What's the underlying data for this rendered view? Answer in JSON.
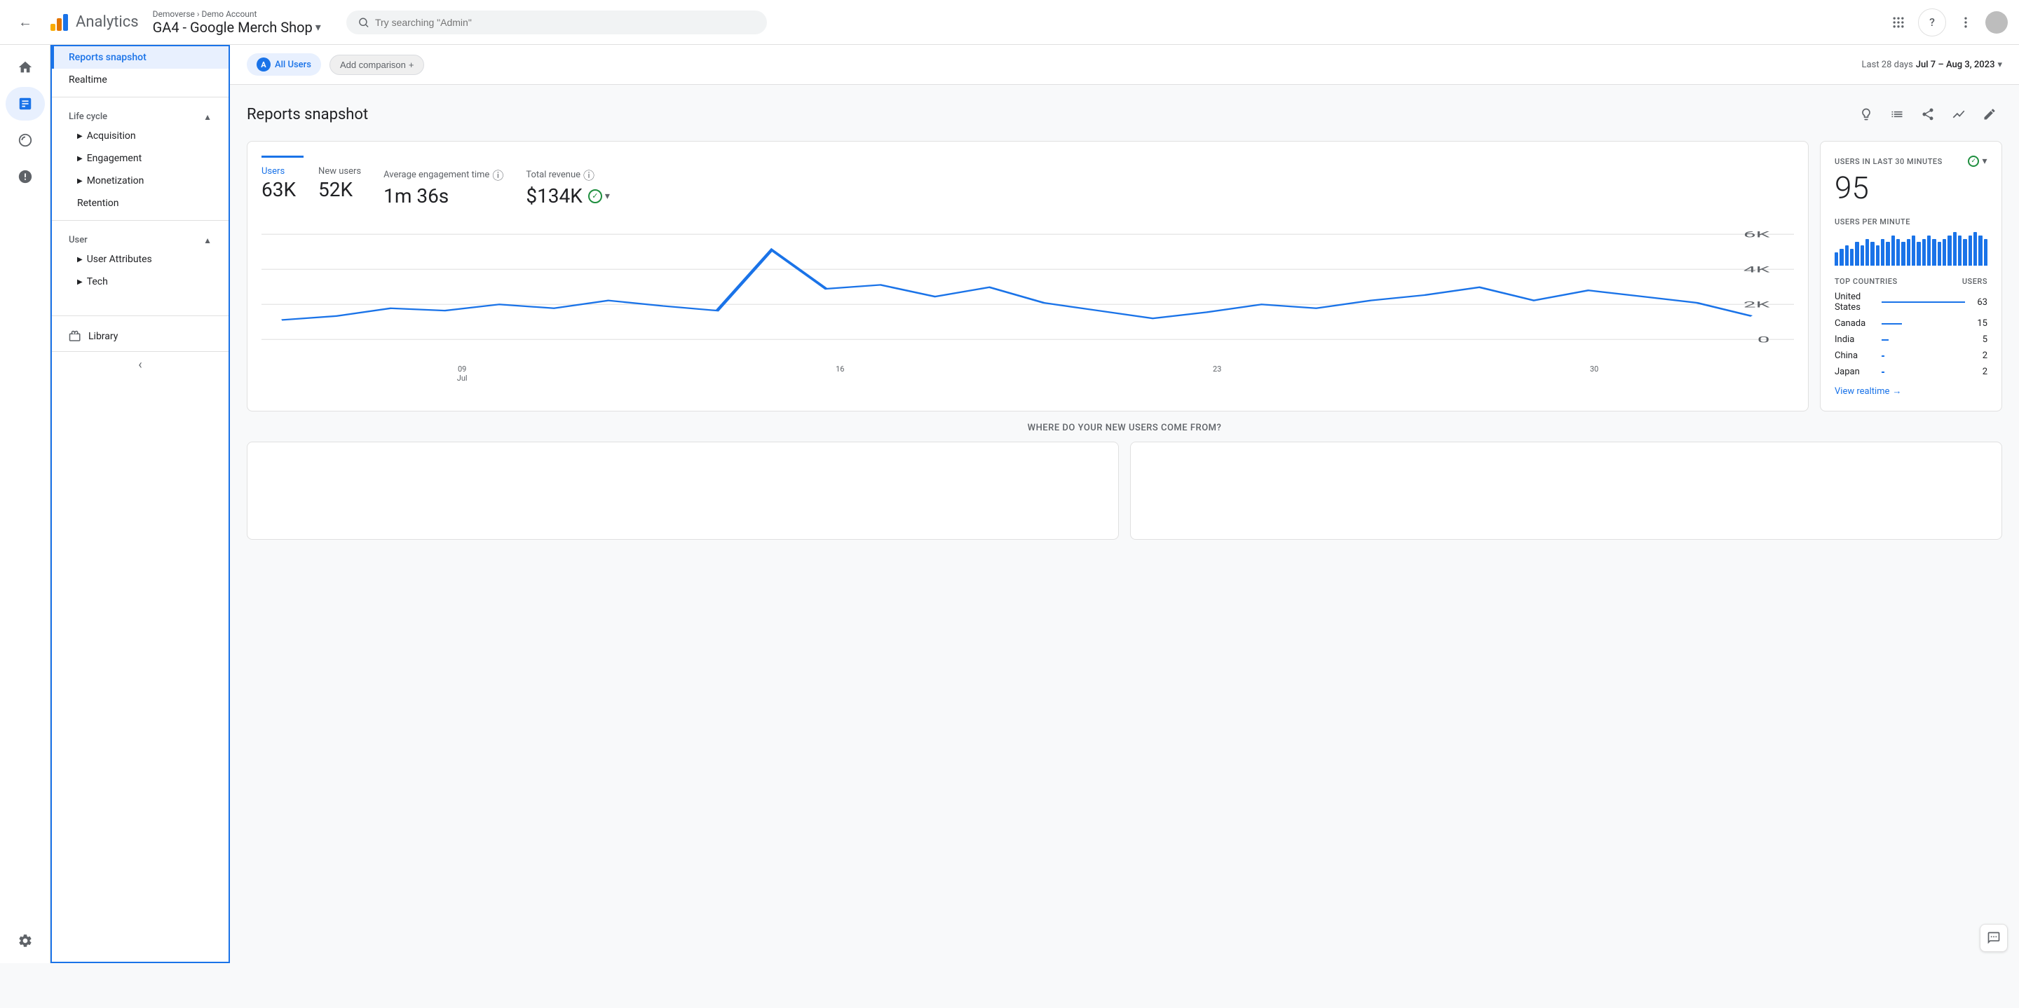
{
  "header": {
    "back_icon": "←",
    "logo_alt": "Google Analytics logo",
    "app_name": "Analytics",
    "breadcrumb_org": "Demoverse",
    "breadcrumb_sep": ">",
    "breadcrumb_account": "Demo Account",
    "account_selector": "GA4 - Google Merch Shop",
    "search_placeholder": "Try searching \"Admin\"",
    "apps_icon": "⋮⋮",
    "help_icon": "?",
    "more_icon": "⋮"
  },
  "sidebar": {
    "reports_snapshot_label": "Reports snapshot",
    "realtime_label": "Realtime",
    "lifecycle_label": "Life cycle",
    "acquisition_label": "Acquisition",
    "engagement_label": "Engagement",
    "monetization_label": "Monetization",
    "retention_label": "Retention",
    "user_label": "User",
    "user_attributes_label": "User Attributes",
    "tech_label": "Tech",
    "library_label": "Library",
    "collapse_icon": "‹"
  },
  "content_bar": {
    "all_users_letter": "A",
    "all_users_label": "All Users",
    "add_comparison_label": "Add comparison",
    "add_icon": "+",
    "date_prefix": "Last 28 days",
    "date_range": "Jul 7 – Aug 3, 2023",
    "date_dropdown": "▾"
  },
  "reports": {
    "title": "Reports snapshot",
    "action_icons": [
      "💡",
      "📊",
      "↗",
      "〜",
      "✏"
    ]
  },
  "metrics": {
    "users_label": "Users",
    "users_value": "63K",
    "new_users_label": "New users",
    "new_users_value": "52K",
    "avg_engagement_label": "Average engagement time",
    "avg_engagement_value": "1m 36s",
    "total_revenue_label": "Total revenue",
    "total_revenue_value": "$134K"
  },
  "chart": {
    "y_labels": [
      "6K",
      "4K",
      "2K",
      "0"
    ],
    "x_labels": [
      "09\nJul",
      "16",
      "23",
      "30"
    ],
    "data_points": [
      30,
      35,
      38,
      36,
      40,
      37,
      42,
      38,
      35,
      65,
      45,
      48,
      42,
      45,
      40,
      38,
      35,
      37,
      40,
      38,
      42,
      45,
      48,
      42,
      45,
      42,
      40,
      38
    ]
  },
  "realtime": {
    "label": "USERS IN LAST 30 MINUTES",
    "value": "95",
    "per_minute_label": "USERS PER MINUTE",
    "mini_bars": [
      4,
      5,
      6,
      5,
      7,
      6,
      8,
      7,
      6,
      8,
      7,
      9,
      8,
      7,
      8,
      9,
      7,
      8,
      9,
      8,
      7,
      8,
      9,
      10,
      9,
      8,
      9,
      10,
      9,
      8
    ],
    "countries_header_label": "TOP COUNTRIES",
    "countries_header_users": "USERS",
    "countries": [
      {
        "name": "United States",
        "count": 63,
        "bar_pct": 100
      },
      {
        "name": "Canada",
        "count": 15,
        "bar_pct": 24
      },
      {
        "name": "India",
        "count": 5,
        "bar_pct": 8
      },
      {
        "name": "China",
        "count": 2,
        "bar_pct": 3
      },
      {
        "name": "Japan",
        "count": 2,
        "bar_pct": 3
      }
    ],
    "view_realtime_label": "View realtime",
    "view_realtime_arrow": "→"
  },
  "bottom_section": {
    "title": "WHERE DO YOUR NEW USERS COME FROM?"
  },
  "icon_rail": {
    "home_icon": "⌂",
    "reports_icon": "📊",
    "explore_icon": "◎",
    "advertising_icon": "🎯",
    "settings_icon": "⚙"
  }
}
